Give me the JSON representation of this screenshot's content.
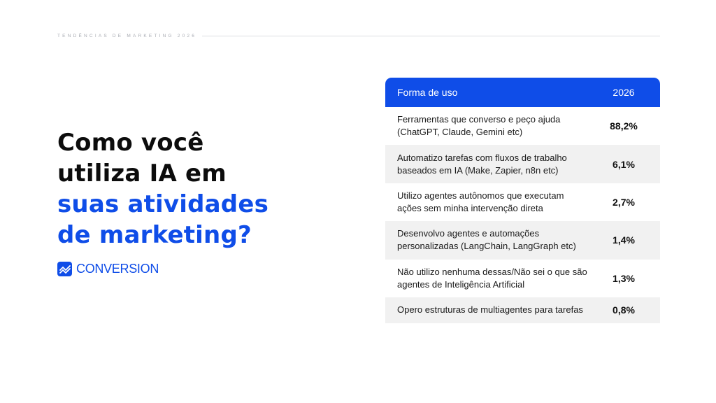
{
  "header": {
    "label": "TENDÊNCIAS DE MARKETING 2026"
  },
  "headline": {
    "line1": "Como você",
    "line2": "utiliza IA em",
    "line3": "suas atividades",
    "line4": "de marketing?"
  },
  "brand": {
    "name": "CONVERSION",
    "icon": "chart-trend-icon"
  },
  "table": {
    "columns": [
      "Forma de uso",
      "2026"
    ],
    "rows": [
      {
        "label": "Ferramentas que converso e peço ajuda (ChatGPT, Claude, Gemini etc)",
        "value": "88,2%"
      },
      {
        "label": "Automatizo tarefas com fluxos de trabalho baseados em IA (Make, Zapier, n8n etc)",
        "value": "6,1%"
      },
      {
        "label": "Utilizo agentes autônomos que executam ações sem minha intervenção direta",
        "value": "2,7%"
      },
      {
        "label": "Desenvolvo agentes e automações personalizadas (LangChain, LangGraph etc)",
        "value": "1,4%"
      },
      {
        "label": "Não utilizo nenhuma dessas/Não sei o que são agentes de Inteligência Artificial",
        "value": "1,3%"
      },
      {
        "label": "Opero estruturas de multiagentes para tarefas",
        "value": "0,8%"
      }
    ]
  },
  "colors": {
    "accent": "#0f4de8",
    "text": "#0c0c0c",
    "row_alt": "#f1f1f1"
  }
}
